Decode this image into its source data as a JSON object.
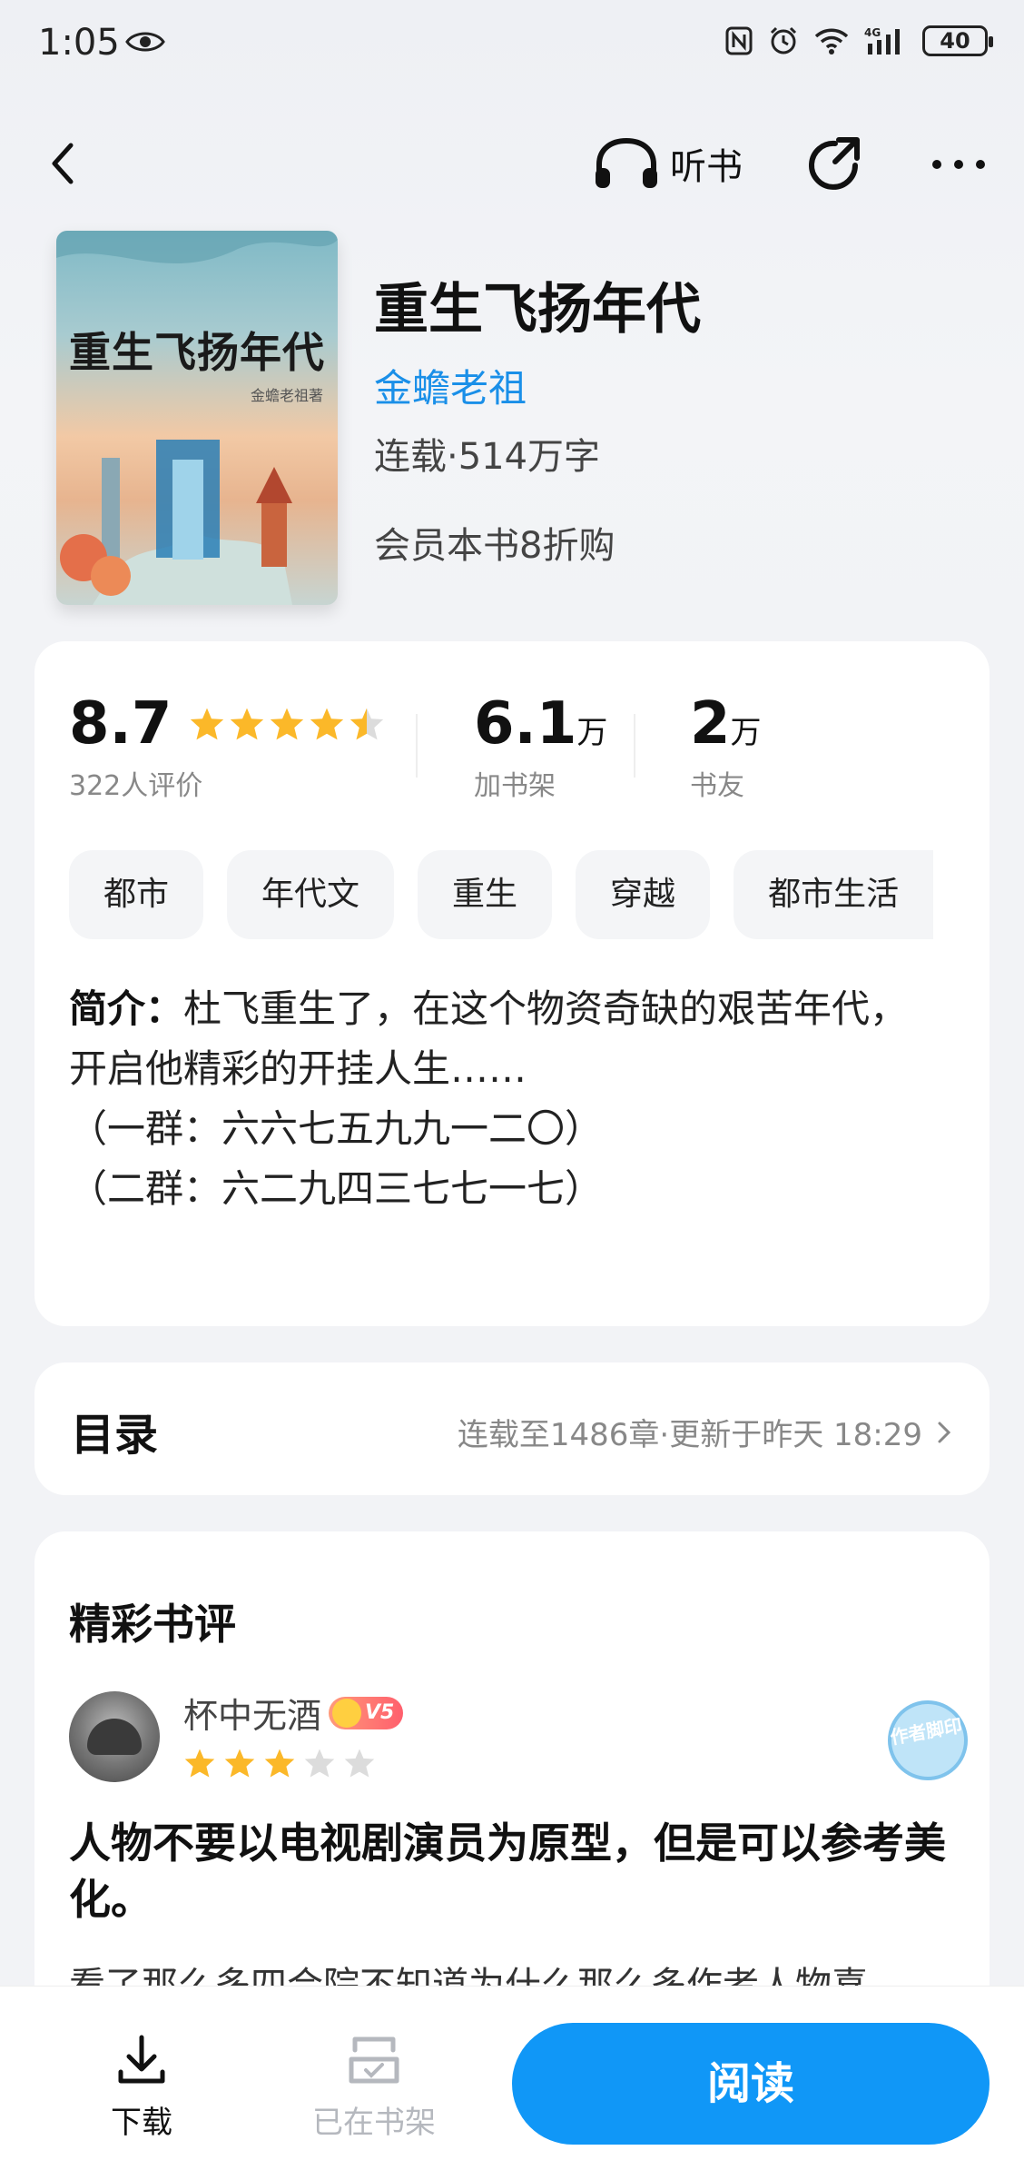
{
  "status_bar": {
    "time": "1:05",
    "network": "4G",
    "battery": "40"
  },
  "nav": {
    "listen_label": "听书",
    "icons": [
      "back-arrow-icon",
      "headphones-icon",
      "share-icon",
      "more-icon"
    ]
  },
  "book": {
    "cover_title": "重生飞扬年代",
    "cover_author": "金蟾老祖著",
    "title": "重生飞扬年代",
    "author": "金蟾老祖",
    "status": "连载·514万字",
    "promo": "会员本书8折购"
  },
  "stats": {
    "rating": "8.7",
    "rating_stars": 4.5,
    "rating_count": "322人评价",
    "shelf_count": "6.1",
    "shelf_unit": "万",
    "shelf_label": "加书架",
    "friends_count": "2",
    "friends_unit": "万",
    "friends_label": "书友"
  },
  "tags": [
    "都市",
    "年代文",
    "重生",
    "穿越",
    "都市生活"
  ],
  "intro": {
    "label": "简介：",
    "line1": "杜飞重生了，在这个物资奇缺的艰苦年代，",
    "line2": "开启他精彩的开挂人生……",
    "line3": "（一群：六六七五九九一二〇）",
    "line4": "（二群：六二九四三七七一七）"
  },
  "toc": {
    "title": "目录",
    "info": "连载至1486章·更新于昨天 18:29"
  },
  "reviews": {
    "heading": "精彩书评",
    "reviewer_name": "杯中无酒",
    "vip_badge": "V5",
    "review_stars": 3,
    "stamp_text": "作者脚印",
    "title": "人物不要以电视剧演员为原型，但是可以参考美化。",
    "body": "看了那么多四合院不知道为什么那么多作者人物喜"
  },
  "bottom_bar": {
    "download_label": "下载",
    "shelf_label": "已在书架",
    "read_label": "阅读"
  },
  "colors": {
    "accent": "#1097f7",
    "author_link": "#1a8fe8",
    "star": "#fbb829"
  }
}
